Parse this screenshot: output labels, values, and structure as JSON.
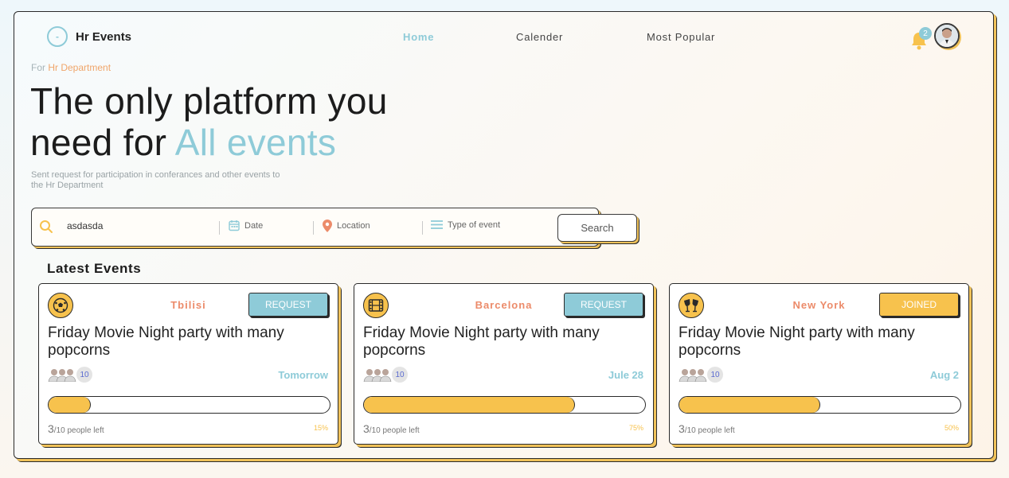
{
  "header": {
    "logo_glyph": "-",
    "app_name": "Hr Events",
    "nav": [
      "Home",
      "Calender",
      "Most Popular"
    ],
    "notification_count": "2"
  },
  "hero": {
    "eyebrow_prefix": "For ",
    "eyebrow_highlight": "Hr Department",
    "title_line1": "The only platform you",
    "title_line2_prefix": "need for ",
    "title_accent": "All events",
    "subtitle": "Sent request for participation in conferances and other events to the Hr Department"
  },
  "search": {
    "value": "asdasda",
    "date_label": "Date",
    "location_label": "Location",
    "type_label": "Type of event",
    "button_label": "Search"
  },
  "section_title": "Latest Events",
  "events": [
    {
      "icon": "soccer-ball-icon",
      "city": "Tbilisi",
      "action": "REQUEST",
      "title": "Friday Movie Night party with many popcorns",
      "participants": "10",
      "date": "Tomorrow",
      "filled": "3",
      "total": "/10 people left",
      "percent_label": "15%",
      "progress": 0.15
    },
    {
      "icon": "film-icon",
      "city": "Barcelona",
      "action": "REQUEST",
      "title": "Friday Movie Night party with many popcorns",
      "participants": "10",
      "date": "Jule 28",
      "filled": "3",
      "total": "/10 people left",
      "percent_label": "75%",
      "progress": 0.75
    },
    {
      "icon": "cheers-glasses-icon",
      "city": "New York",
      "action": "JOINED",
      "title": "Friday Movie Night party with many popcorns",
      "participants": "10",
      "date": "Aug 2",
      "filled": "3",
      "total": "/10 people left",
      "percent_label": "50%",
      "progress": 0.5
    }
  ],
  "colors": {
    "accent": "#8ecbd8",
    "yellow": "#f7c24d",
    "city": "#ec8b6a"
  }
}
